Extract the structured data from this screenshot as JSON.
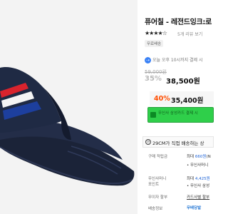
{
  "product": {
    "title": "퓨어칠 - 레전드잉크:로",
    "stars": "★★★★☆",
    "review_count": "5개 리뷰 보기",
    "badge": "무료배송",
    "delivery_note": "오늘 오후 10시까지 결제 시",
    "original_price": "59,000원",
    "discount_rate": "35%",
    "sale_price": "38,500원",
    "coupon_rate": "40%",
    "coupon_price": "35,400원",
    "promo_banner": "무신사 삼성카드 결제 시",
    "shipping_note": "29CM가 직접 배송하는 상"
  },
  "details": [
    {
      "label": "구매 적립금",
      "value_prefix": "최대 ",
      "value_highlight": "660원",
      "value_suffix": "(N",
      "sub": "• 무신사머니"
    },
    {
      "label": "무신사머니",
      "label2": "포인트",
      "value_prefix": "최대 ",
      "value_highlight": "4,425원",
      "value_suffix": "",
      "sub": "• 무신사 삼성"
    },
    {
      "label": "무이자 할부",
      "value_prefix": "카드사별 할부",
      "value_highlight": "",
      "value_suffix": "",
      "sub": ""
    },
    {
      "label": "배송정보",
      "value_prefix": "",
      "value_highlight": "",
      "value_suffix": "",
      "sub": ""
    }
  ],
  "pay_badge": "무배당발",
  "colors": {
    "discount_orange": "#ff4d00",
    "promo_green": "#2fcf4a",
    "link_blue": "#1e63d6",
    "stripe_red": "#d9232d",
    "stripe_white": "#f4f4f4",
    "stripe_blue": "#1d3f9e",
    "sandal_navy": "#1f2a44"
  }
}
